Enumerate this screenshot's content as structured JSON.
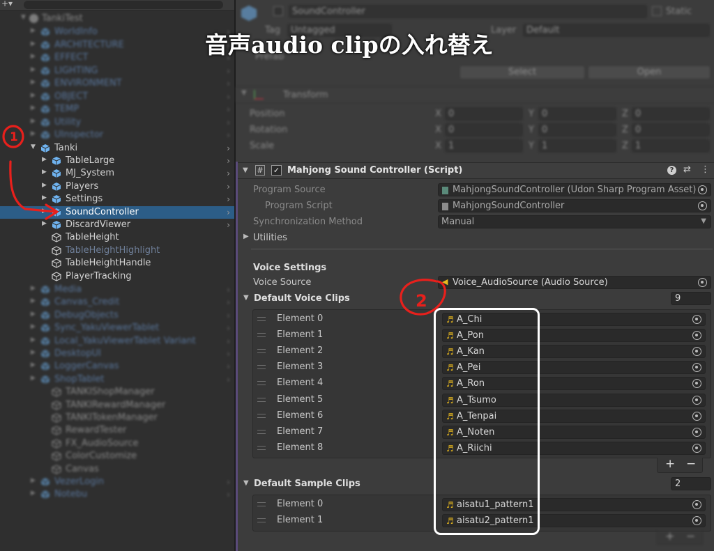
{
  "hierarchy": {
    "root": "TankiTest",
    "blurred_above": [
      "WorldInfo",
      "ARCHITECTURE",
      "EFFECT",
      "LIGHTING",
      "ENVIRONMENT",
      "OBJECT",
      "TEMP",
      "Utility",
      "UInspector"
    ],
    "tanki": "Tanki",
    "children": [
      {
        "label": "TableLarge",
        "prefab": true
      },
      {
        "label": "MJ_System",
        "prefab": true
      },
      {
        "label": "Players",
        "prefab": true
      },
      {
        "label": "Settings",
        "prefab": true
      },
      {
        "label": "SoundController",
        "prefab": true,
        "selected": true
      },
      {
        "label": "DiscardViewer",
        "prefab": true
      },
      {
        "label": "TableHeight",
        "prefab": false
      },
      {
        "label": "TableHeightHighlight",
        "prefab": false,
        "inactive": true
      },
      {
        "label": "TableHeightHandle",
        "prefab": false
      },
      {
        "label": "PlayerTracking",
        "prefab": false
      }
    ],
    "blurred_below": [
      "Media",
      "Canvas_Credit",
      "DebugObjects",
      "Sync_YakuViewerTablet",
      "Local_YakuViewerTablet Variant",
      "DesktopUI",
      "LoggerCanvas",
      "ShopTablet",
      "TANKIShopManager",
      "TANKIRewardManager",
      "TANKITokenManager",
      "RewardTester",
      "FX_AudioSource",
      "ColorCustomize",
      "Canvas",
      "VezerLogin",
      "Notebu"
    ]
  },
  "inspector": {
    "object_name": "SoundController",
    "static_label": "Static",
    "tag_label": "Tag",
    "tag_value": "Untagged",
    "layer_label": "Layer",
    "layer_value": "Default",
    "prefab_label": "Prefab",
    "select_button": "Select",
    "open_button": "Open",
    "transform": {
      "title": "Transform",
      "rows": [
        {
          "label": "Position",
          "x": "0",
          "y": "0",
          "z": "0"
        },
        {
          "label": "Rotation",
          "x": "0",
          "y": "0",
          "z": "0"
        },
        {
          "label": "Scale",
          "x": "1",
          "y": "1",
          "z": "1"
        }
      ]
    },
    "script": {
      "title": "Mahjong Sound Controller (Script)",
      "program_source_label": "Program Source",
      "program_source_value": "MahjongSoundController (Udon Sharp Program Asset)",
      "program_script_label": "Program Script",
      "program_script_value": "MahjongSoundController",
      "sync_label": "Synchronization Method",
      "sync_value": "Manual",
      "utilities_label": "Utilities",
      "voice_settings_header": "Voice Settings",
      "voice_source_label": "Voice Source",
      "voice_source_value": "Voice_AudioSource (Audio Source)",
      "default_voice_clips_label": "Default Voice Clips",
      "default_voice_clips_count": "9",
      "voice_clips": [
        {
          "label": "Element 0",
          "value": "A_Chi"
        },
        {
          "label": "Element 1",
          "value": "A_Pon"
        },
        {
          "label": "Element 2",
          "value": "A_Kan"
        },
        {
          "label": "Element 3",
          "value": "A_Pei"
        },
        {
          "label": "Element 4",
          "value": "A_Ron"
        },
        {
          "label": "Element 5",
          "value": "A_Tsumo"
        },
        {
          "label": "Element 6",
          "value": "A_Tenpai"
        },
        {
          "label": "Element 7",
          "value": "A_Noten"
        },
        {
          "label": "Element 8",
          "value": "A_Riichi"
        }
      ],
      "default_sample_clips_label": "Default Sample Clips",
      "default_sample_clips_count": "2",
      "sample_clips": [
        {
          "label": "Element 0",
          "value": "aisatu1_pattern1"
        },
        {
          "label": "Element 1",
          "value": "aisatu2_pattern1"
        }
      ],
      "add_symbol": "+",
      "remove_symbol": "−"
    }
  },
  "overlay": {
    "title": "音声audio clipの入れ替え",
    "marker_1": "1",
    "marker_2": "2",
    "annotation_color": "#e8201c",
    "box_color": "#ffffff"
  },
  "colors": {
    "selection": "#2c5d87",
    "prefab_blue": "#7aaef2",
    "audio_icon": "#e9b91e"
  }
}
